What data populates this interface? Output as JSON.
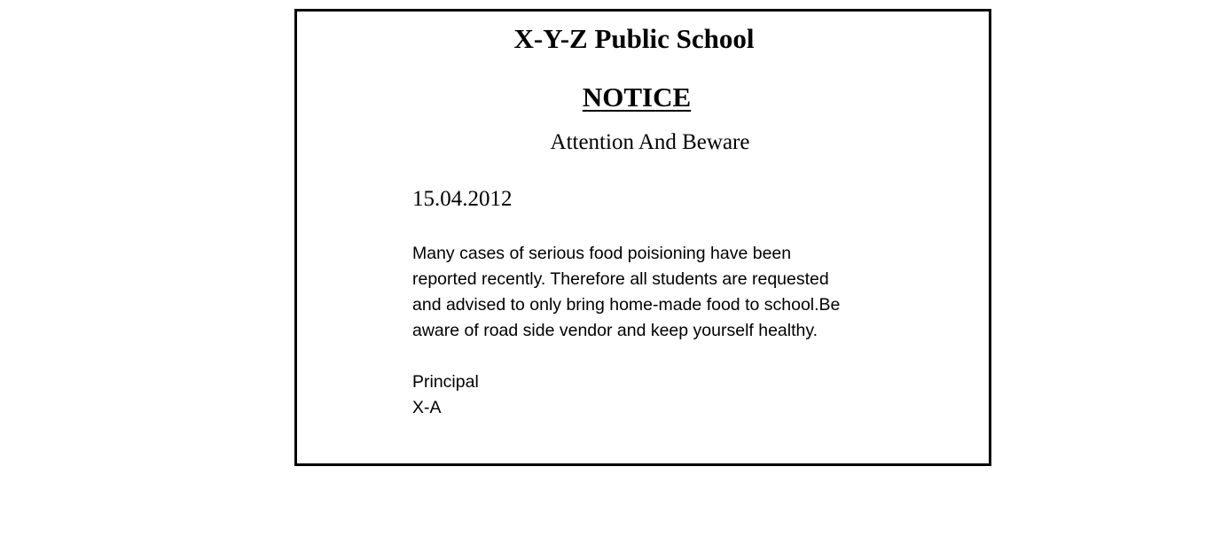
{
  "notice": {
    "school_name": "X-Y-Z Public School",
    "heading": "NOTICE",
    "subject": "Attention And Beware",
    "date": "15.04.2012",
    "body_lines": [
      "Many cases of serious food poisioning have been",
      "reported recently. Therefore all students are requested",
      "and advised to only bring home-made food to school.Be",
      "aware of road side vendor and keep yourself healthy."
    ],
    "signatory_title": "Principal",
    "signatory_name": "X-A"
  },
  "colors": {
    "border": "#000000",
    "text": "#000000",
    "background": "#ffffff"
  }
}
